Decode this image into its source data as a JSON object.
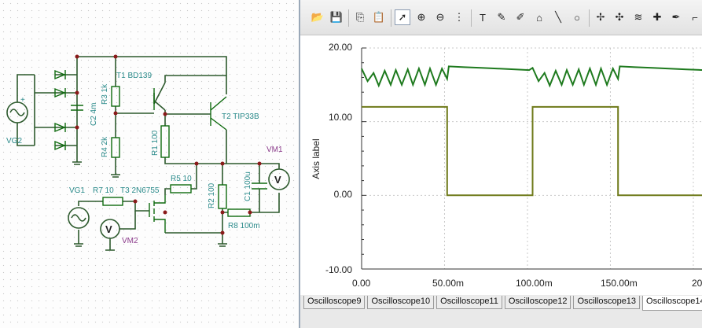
{
  "schematic": {
    "components": {
      "vg2": "VG2",
      "c2": "C2 4m",
      "r3": "R3 1k",
      "t1": "T1 BD139",
      "r4": "R4 2k",
      "r1": "R1 100",
      "t2": "T2 TIP33B",
      "vm1": "VM1",
      "vg1": "VG1",
      "r7": "R7 10",
      "t3": "T3 2N6755",
      "r5": "R5 10",
      "r2": "R2 100",
      "c1": "C1 100u",
      "r8": "R8 100m",
      "vm2": "VM2",
      "meter_symbol": "V"
    }
  },
  "oscilloscope": {
    "toolbar": {
      "tools": [
        {
          "name": "open-icon",
          "glyph": "📂"
        },
        {
          "name": "save-icon",
          "glyph": "💾"
        },
        {
          "name": "copy-icon",
          "glyph": "⎘"
        },
        {
          "name": "paste-icon",
          "glyph": "📋"
        },
        {
          "name": "pointer-icon",
          "glyph": "➚"
        },
        {
          "name": "zoom-in-icon",
          "glyph": "⊕"
        },
        {
          "name": "zoom-100-icon",
          "glyph": "⊖"
        },
        {
          "name": "grid-icon",
          "glyph": "⋮"
        },
        {
          "name": "text-tool-icon",
          "glyph": "T"
        },
        {
          "name": "annotate-icon",
          "glyph": "✎"
        },
        {
          "name": "pen-arrow-icon",
          "glyph": "✐"
        },
        {
          "name": "wave-marker-icon",
          "glyph": "⌂"
        },
        {
          "name": "line-tool-icon",
          "glyph": "╲"
        },
        {
          "name": "circle-tool-icon",
          "glyph": "○"
        },
        {
          "name": "cursor-a-icon",
          "glyph": "✢"
        },
        {
          "name": "cursor-b-icon",
          "glyph": "✣"
        },
        {
          "name": "waveform-icon",
          "glyph": "≋"
        },
        {
          "name": "add-trace-icon",
          "glyph": "✚"
        },
        {
          "name": "eyedropper-icon",
          "glyph": "✒"
        },
        {
          "name": "corner-icon",
          "glyph": "⌐"
        }
      ]
    },
    "tabs": [
      "Oscilloscope9",
      "Oscilloscope10",
      "Oscilloscope11",
      "Oscilloscope12",
      "Oscilloscope13",
      "Oscilloscope14"
    ],
    "active_tab": 5,
    "axis_label": "Axis label",
    "y_ticks": [
      "20.00",
      "10.00",
      "0.00",
      "-10.00"
    ],
    "x_ticks": [
      "0.00",
      "50.00m",
      "100.00m",
      "150.00m",
      "20"
    ]
  },
  "chart_data": {
    "type": "line",
    "ylabel": "Axis label",
    "xlabel": "",
    "xlim": [
      0,
      0.2
    ],
    "ylim": [
      -10,
      20
    ],
    "grid": true,
    "series": [
      {
        "color": "#6f7a1a",
        "x": [
          0,
          0.05,
          0.05,
          0.1,
          0.1,
          0.15,
          0.15,
          0.2
        ],
        "y": [
          12,
          12,
          0,
          0,
          12,
          12,
          0,
          0
        ]
      },
      {
        "color": "#1e7a1e",
        "x": [
          0,
          0.0035,
          0.007,
          0.01,
          0.0135,
          0.017,
          0.02,
          0.0235,
          0.027,
          0.03,
          0.0335,
          0.037,
          0.04,
          0.0435,
          0.047,
          0.05,
          0.051,
          0.06,
          0.07,
          0.08,
          0.09,
          0.098,
          0.1,
          0.1035,
          0.107,
          0.11,
          0.1135,
          0.117,
          0.12,
          0.1235,
          0.127,
          0.13,
          0.1335,
          0.137,
          0.14,
          0.1435,
          0.147,
          0.15,
          0.151,
          0.16,
          0.17,
          0.18,
          0.19,
          0.2
        ],
        "y": [
          17.2,
          15.5,
          16.6,
          14.9,
          16.9,
          15.0,
          17.0,
          15.0,
          17.1,
          15.0,
          17.2,
          15.0,
          17.2,
          15.0,
          17.2,
          15.8,
          17.5,
          17.4,
          17.3,
          17.2,
          17.1,
          17.0,
          17.3,
          15.5,
          16.6,
          14.9,
          16.9,
          15.0,
          17.0,
          15.0,
          17.1,
          15.0,
          17.2,
          15.0,
          17.2,
          15.0,
          17.2,
          15.8,
          17.5,
          17.4,
          17.3,
          17.2,
          17.1,
          17.0
        ]
      }
    ]
  }
}
